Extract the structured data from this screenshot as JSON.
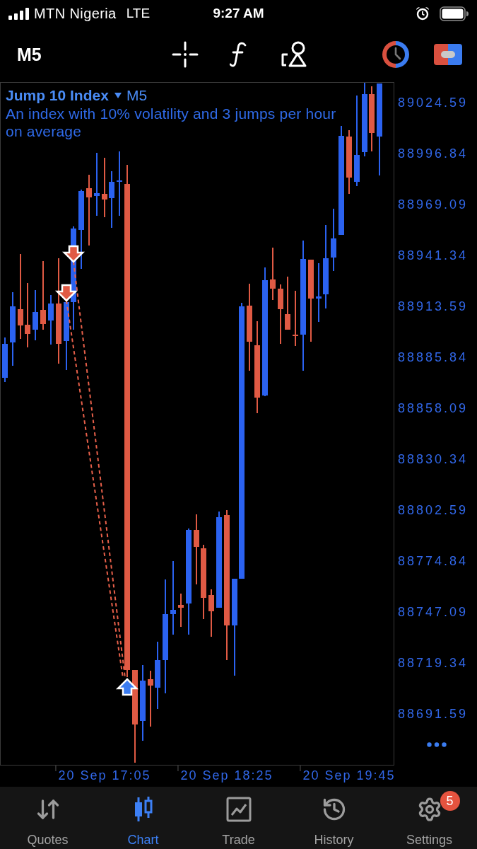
{
  "status_bar": {
    "carrier": "MTN Nigeria",
    "network": "LTE",
    "time": "9:27 AM"
  },
  "toolbar": {
    "timeframe": "M5"
  },
  "chart": {
    "symbol": "Jump 10 Index",
    "timeframe": "M5",
    "description": "An index with 10% volatility and 3 jumps per hour on average",
    "chart_data": {
      "type": "candlestick",
      "categories": [
        null,
        null,
        null,
        null,
        null,
        null,
        null,
        null,
        null,
        null,
        null,
        null,
        null,
        "20 Sep 17:05",
        null,
        null,
        null,
        null,
        null,
        null,
        null,
        null,
        null,
        null,
        null,
        null,
        null,
        null,
        null,
        "20 Sep 18:25",
        null,
        null,
        null,
        null,
        null,
        null,
        null,
        null,
        null,
        null,
        null,
        null,
        null,
        null,
        null,
        "20 Sep 19:45",
        null,
        null,
        null,
        null
      ],
      "ohlc": [
        [
          88875.05,
          88897.02,
          88872.74,
          88893.55
        ],
        [
          88894.32,
          88921.68,
          88881.6,
          88913.98
        ],
        [
          88912.43,
          88942.5,
          88896.25,
          88903.57
        ],
        [
          88903.95,
          88926.69,
          88891.62,
          88898.94
        ],
        [
          88901.26,
          88922.84,
          88895.48,
          88910.89
        ],
        [
          88912.05,
          88938.64,
          88901.26,
          88904.34
        ],
        [
          88906.27,
          88920.14,
          88893.16,
          88915.52
        ],
        [
          88915.52,
          88940.18,
          88882.76,
          88893.55
        ],
        [
          88895.09,
          88916.29,
          88879.29,
          88916.29
        ],
        [
          88916.29,
          88957.53,
          88901.26,
          88956.37
        ],
        [
          88955.6,
          88977.57,
          88934.4,
          88976.8
        ],
        [
          88978.34,
          88985.66,
          88947.12,
          88973.33
        ],
        [
          88974.1,
          88997.61,
          88963.31,
          88975.64
        ],
        [
          88975.26,
          88994.91,
          88962.54,
          88972.17
        ],
        [
          88972.94,
          88987.59,
          88956.76,
          88981.81
        ],
        [
          88981.81,
          88998.38,
          88963.31,
          88982.58
        ],
        [
          88980.65,
          88991.06,
          88712.02,
          88715.87
        ],
        [
          88715.87,
          88715.87,
          88665.38,
          88686.19
        ],
        [
          88688.12,
          88718.57,
          88677.33,
          88710.09
        ],
        [
          88710.86,
          88715.49,
          88685.04,
          88707.39
        ],
        [
          88706.24,
          88731.29,
          88694.67,
          88721.27
        ],
        [
          88721.27,
          88765.21,
          88703.15,
          88746.32
        ],
        [
          88746.32,
          88775.23,
          88735.14,
          88748.63
        ],
        [
          88751.33,
          88757.5,
          88739.38,
          88749.79
        ],
        [
          88752.1,
          88792.95,
          88735.14,
          88792.18
        ],
        [
          88792.18,
          88800.66,
          88762.51,
          88782.93
        ],
        [
          88782.16,
          88784.09,
          88743.62,
          88755.18
        ],
        [
          88756.73,
          88759.81,
          88733.99,
          88747.86
        ],
        [
          88749.79,
          88802.2,
          88749.79,
          88799.12
        ],
        [
          88800.28,
          88802.98,
          88721.27,
          88740.15
        ],
        [
          88740.15,
          88765.59,
          88712.79,
          88765.59
        ],
        [
          88765.59,
          88915.9,
          88765.59,
          88913.98
        ],
        [
          88914.36,
          88926.31,
          88878.9,
          88894.7
        ],
        [
          88892.78,
          88905.88,
          88855.78,
          88864.26
        ],
        [
          88865.41,
          88935.17,
          88865.03,
          88928.24
        ],
        [
          88928.62,
          88945.96,
          88917.44,
          88923.61
        ],
        [
          88923.61,
          88925.92,
          88893.55,
          88912.43
        ],
        [
          88909.74,
          88930.16,
          88901.26,
          88901.26
        ],
        [
          88898.56,
          88922.45,
          88892.39,
          88897.79
        ],
        [
          88898.56,
          88949.82,
          88878.9,
          88939.8
        ],
        [
          88939.41,
          88939.41,
          88894.7,
          88918.21
        ],
        [
          88918.21,
          88937.49,
          88905.5,
          88919.37
        ],
        [
          88920.53,
          88958.3,
          88912.82,
          88940.18
        ],
        [
          88940.57,
          88967.16,
          88933.25,
          88950.98
        ],
        [
          88952.9,
          89012.26,
          88952.9,
          89006.86
        ],
        [
          89006.48,
          89009.94,
          88975.26,
          88984.12
        ],
        [
          88981.81,
          89028.83,
          88979.5,
          88996.45
        ],
        [
          88998.0,
          89035.77,
          88995.68,
          89029.6
        ],
        [
          89029.6,
          89033.84,
          88998.38,
          89008.4
        ],
        [
          89006.48,
          89035.38,
          88985.28,
          89035.38
        ]
      ],
      "ylim": [
        88663.84,
        89035.77
      ],
      "yticks": [
        89024.59,
        88996.84,
        88969.09,
        88941.34,
        88913.59,
        88885.84,
        88858.09,
        88830.34,
        88802.59,
        88774.84,
        88747.09,
        88719.34,
        88691.59
      ]
    }
  },
  "tabs": [
    {
      "label": "Quotes",
      "selected": false
    },
    {
      "label": "Chart",
      "selected": true
    },
    {
      "label": "Trade",
      "selected": false
    },
    {
      "label": "History",
      "selected": false
    },
    {
      "label": "Settings",
      "selected": false,
      "badge": "5"
    }
  ]
}
